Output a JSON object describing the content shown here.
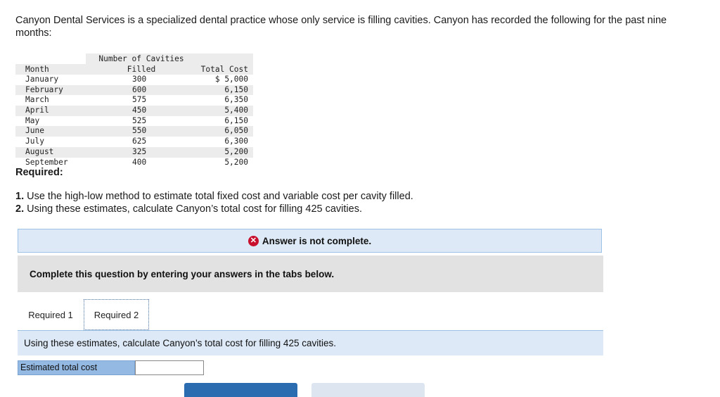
{
  "intro": "Canyon Dental Services is a specialized dental practice whose only service is filling cavities. Canyon has recorded the following for the past nine months:",
  "table": {
    "header_top": {
      "cavities": "Number of Cavities"
    },
    "header_bottom": {
      "month": "Month",
      "cavities": "Filled",
      "cost": "Total Cost"
    },
    "rows": [
      {
        "month": "January",
        "cavities": "300",
        "cost": "$ 5,000"
      },
      {
        "month": "February",
        "cavities": "600",
        "cost": "6,150"
      },
      {
        "month": "March",
        "cavities": "575",
        "cost": "6,350"
      },
      {
        "month": "April",
        "cavities": "450",
        "cost": "5,400"
      },
      {
        "month": "May",
        "cavities": "525",
        "cost": "6,150"
      },
      {
        "month": "June",
        "cavities": "550",
        "cost": "6,050"
      },
      {
        "month": "July",
        "cavities": "625",
        "cost": "6,300"
      },
      {
        "month": "August",
        "cavities": "325",
        "cost": "5,200"
      },
      {
        "month": "September",
        "cavities": "400",
        "cost": "5,200"
      }
    ]
  },
  "required_title": "Required:",
  "questions": [
    {
      "num": "1.",
      "text": " Use the high-low method to estimate total fixed cost and variable cost per cavity filled."
    },
    {
      "num": "2.",
      "text": " Using these estimates, calculate Canyon’s total cost for filling 425 cavities."
    }
  ],
  "answer_banner": {
    "icon": "x-circle-icon",
    "text": "Answer is not complete."
  },
  "instructions": "Complete this question by entering your answers in the tabs below.",
  "tabs": [
    {
      "label": "Required 1"
    },
    {
      "label": "Required 2",
      "active": true
    }
  ],
  "tab_panel_text": "Using these estimates, calculate Canyon’s total cost for filling 425 cavities.",
  "form": {
    "label": "Estimated total cost",
    "value": ""
  },
  "colors": {
    "banner_bg": "#dde9f6",
    "label_bg": "#94b9e3",
    "error_red": "#c8102e",
    "button_blue": "#2b6cb0"
  }
}
